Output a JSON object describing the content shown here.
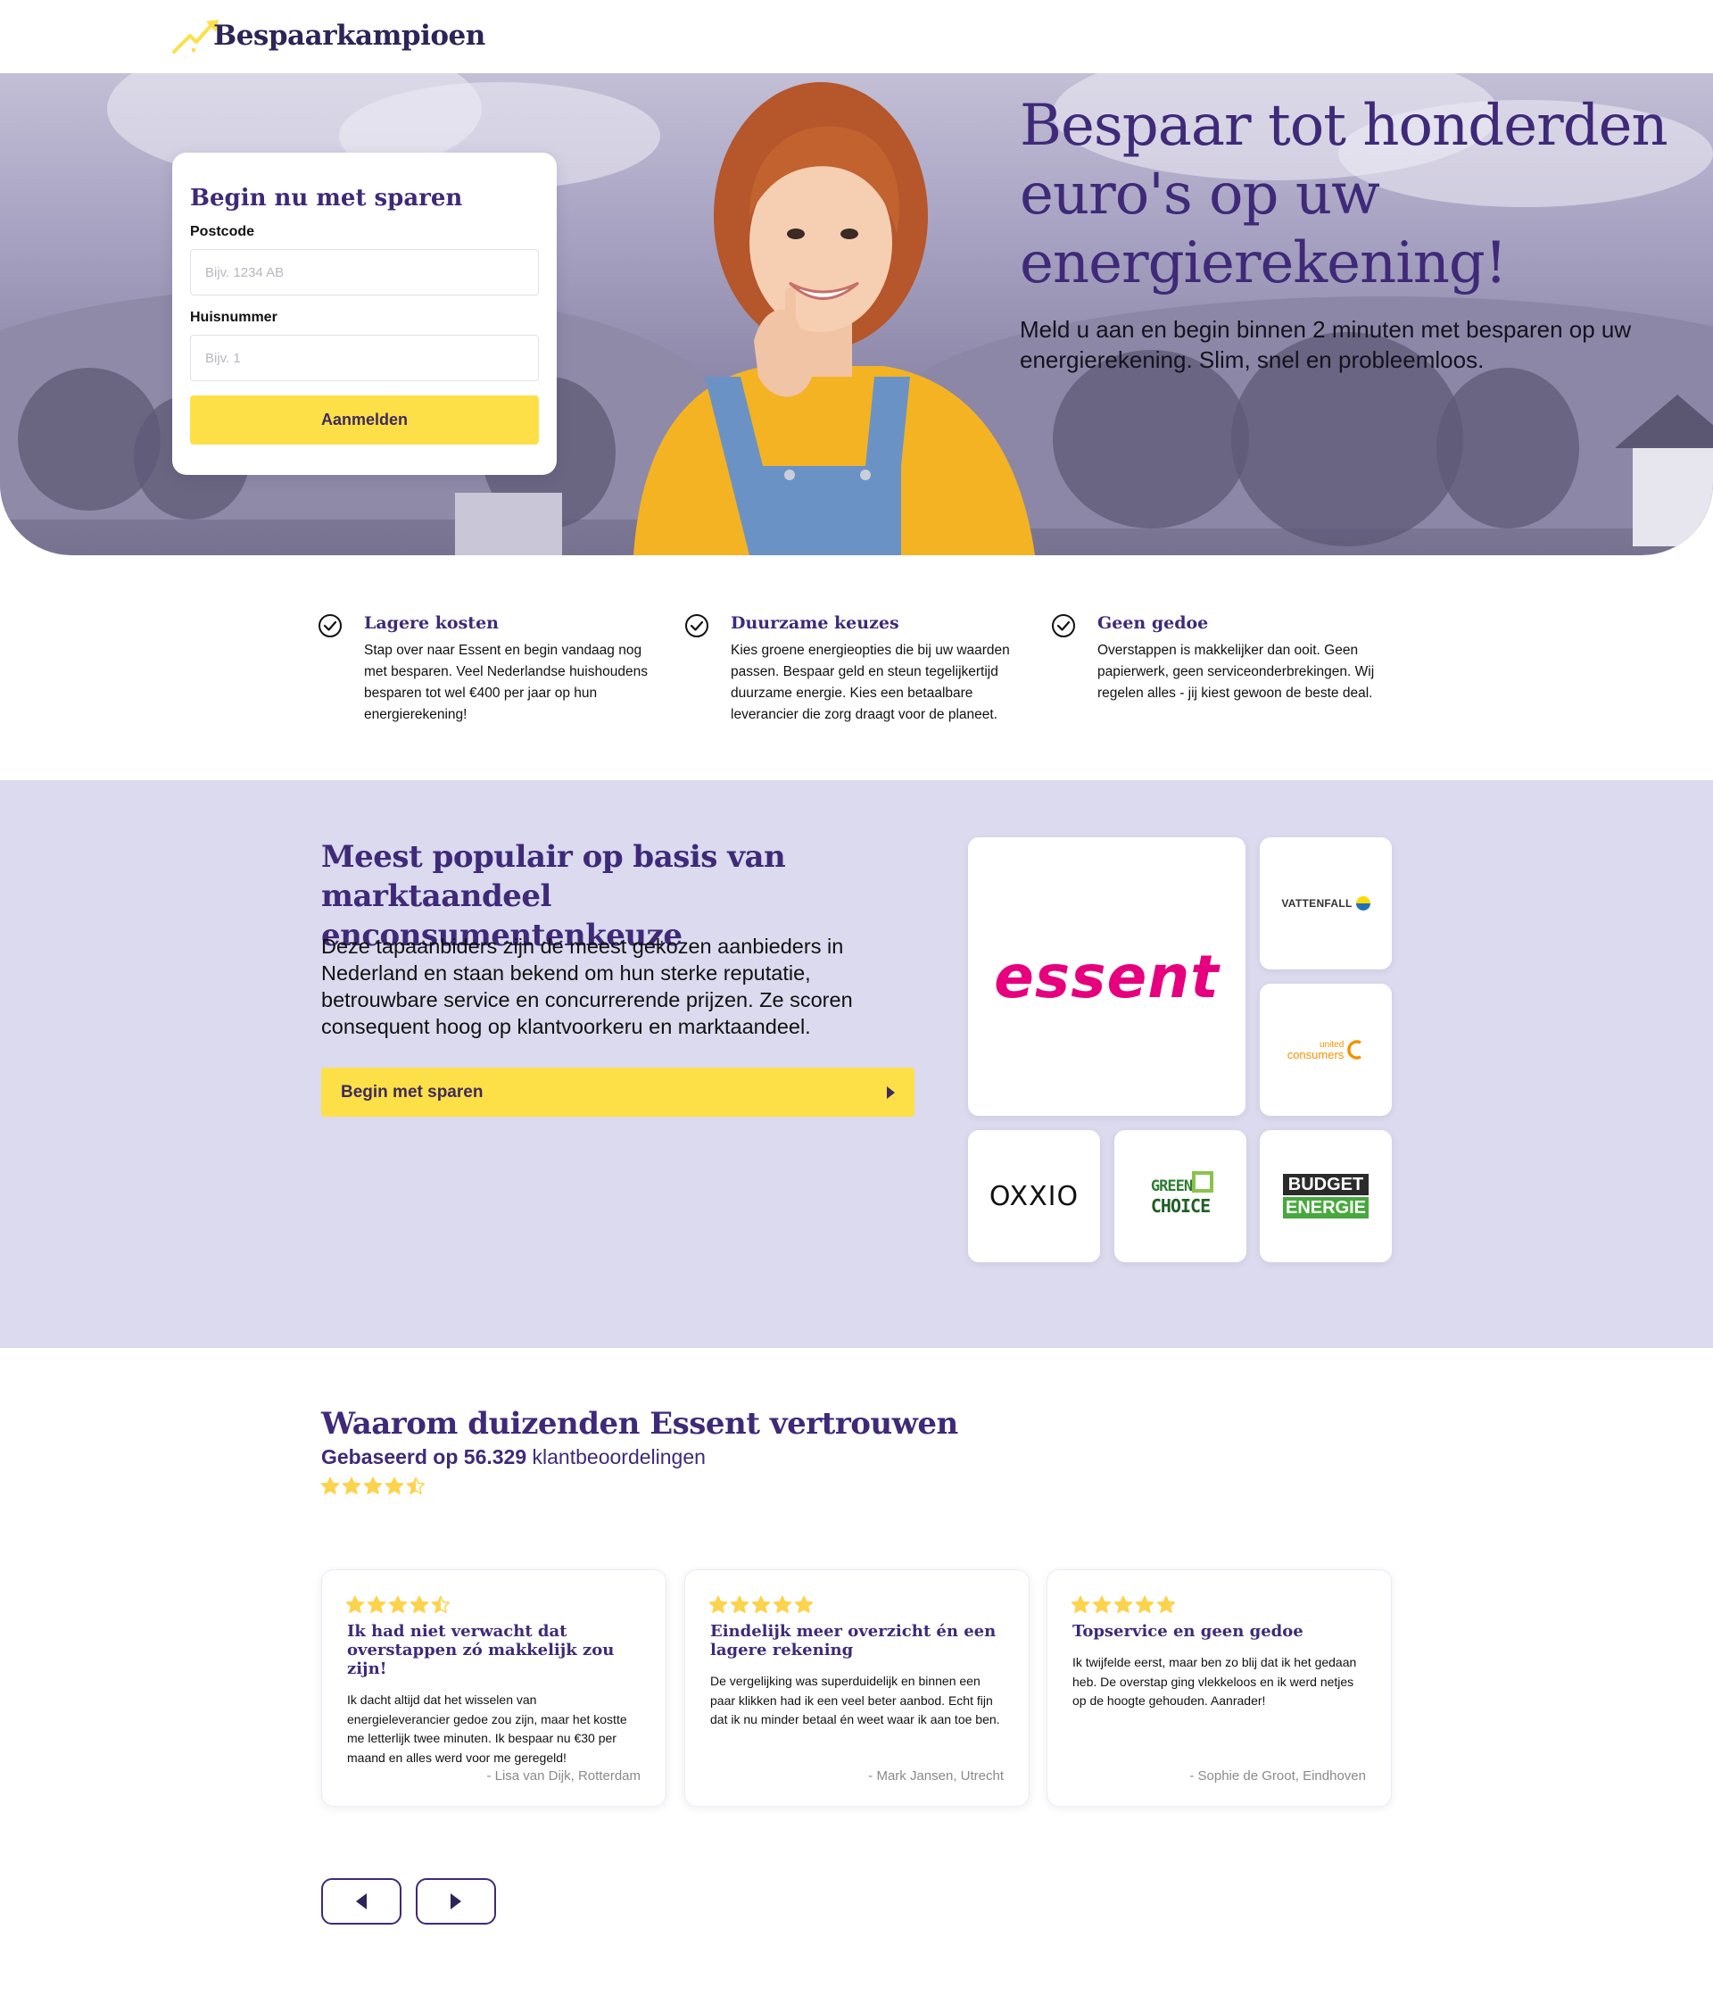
{
  "brand": {
    "name": "Bespaarkampioen"
  },
  "colors": {
    "primary": "#3e2a78",
    "accent": "#fde047",
    "section_bg": "#dbdaee",
    "star": "#fcd34d"
  },
  "signup": {
    "title": "Begin nu met sparen",
    "postcode_label": "Postcode",
    "postcode_placeholder": "Bijv. 1234 AB",
    "huisnummer_label": "Huisnummer",
    "huisnummer_placeholder": "Bijv. 1",
    "submit_label": "Aanmelden"
  },
  "hero": {
    "title": "Bespaar tot honderden euro's op uw energierekening!",
    "subtitle": "Meld u aan en begin binnen 2 minuten met besparen op uw energierekening. Slim, snel en probleemloos."
  },
  "features": [
    {
      "icon": "check-circle-icon",
      "title": "Lagere kosten",
      "text": "Stap over naar Essent en begin vandaag nog met besparen. Veel Nederlandse huishoudens besparen tot wel €400 per jaar op hun energierekening!"
    },
    {
      "icon": "check-circle-icon",
      "title": "Duurzame keuzes",
      "text": "Kies groene energieopties die bij uw waarden passen. Bespaar geld en steun tegelijkertijd duurzame energie. Kies een betaalbare leverancier die zorg draagt voor de planeet."
    },
    {
      "icon": "check-circle-icon",
      "title": "Geen gedoe",
      "text": "Overstappen is makkelijker dan ooit. Geen papierwerk, geen serviceonderbrekingen. Wij regelen alles - jij kiest gewoon de beste deal."
    }
  ],
  "popular": {
    "title": "Meest populair op basis van marktaandeel enconsumentenkeuze",
    "text": "Deze tapaanbiders zijn de meest gekozen aanbieders in Nederland en staan bekend om hun sterke reputatie, betrouwbare service en concurrerende prijzen. Ze scoren consequent hoog op klantvoorkeru en marktaandeel.",
    "button_label": "Begin met sparen",
    "providers": {
      "essent": "essent",
      "vattenfall": "VATTENFALL",
      "united_top": "united",
      "united_bottom": "consumers",
      "oxxio": "OXXIO",
      "greenchoice_top": "GREEN",
      "greenchoice_bottom": "CHOICE",
      "budget_top": "BUDGET",
      "budget_bottom": "ENERGIE"
    }
  },
  "reviews": {
    "title": "Waarom duizenden Essent vertrouwen",
    "based_prefix": "Gebaseerd op",
    "count": "56.329",
    "based_suffix": "klantbeoordelingen",
    "overall_rating": 4.5,
    "items": [
      {
        "rating": 4.5,
        "title": "Ik had niet verwacht dat overstappen zó makkelijk zou zijn!",
        "text": "Ik dacht altijd dat het wisselen van energieleverancier gedoe zou zijn, maar het kostte me letterlijk twee minuten. Ik bespaar nu €30 per maand en alles werd voor me geregeld!",
        "author": "- Lisa van Dijk, Rotterdam"
      },
      {
        "rating": 5,
        "title": "Eindelijk meer overzicht én een lagere rekening",
        "text": "De vergelijking was superduidelijk en binnen een paar klikken had ik een veel beter aanbod. Echt fijn dat ik nu minder betaal én weet waar ik aan toe ben.",
        "author": "- Mark Jansen, Utrecht"
      },
      {
        "rating": 5,
        "title": "Topservice en geen gedoe",
        "text": "Ik twijfelde eerst, maar ben zo blij dat ik het gedaan heb. De overstap ging vlekkeloos en ik werd netjes op de hoogte gehouden. Aanrader!",
        "author": "- Sophie de Groot, Eindhoven"
      }
    ]
  }
}
